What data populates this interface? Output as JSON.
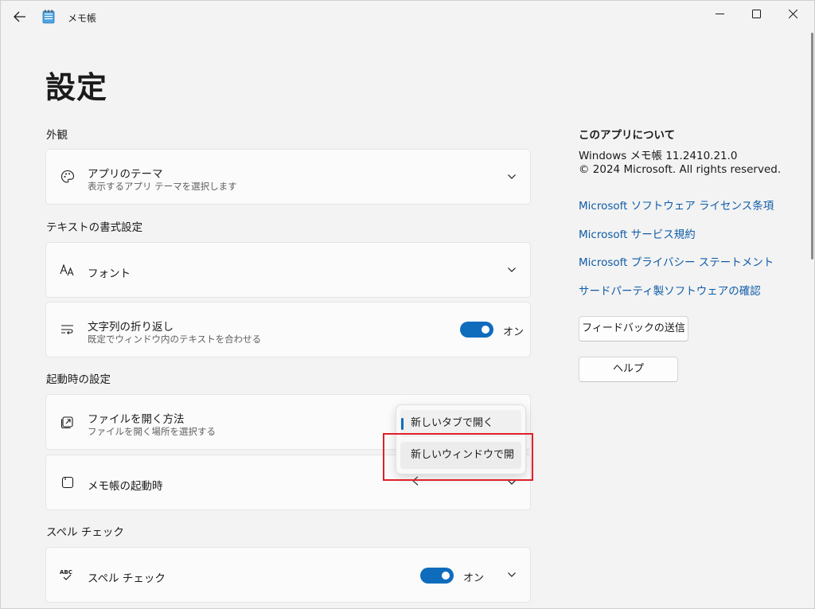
{
  "titlebar": {
    "app_title": "メモ帳"
  },
  "page": {
    "title": "設定"
  },
  "sections": {
    "appearance": "外観",
    "text_format": "テキストの書式設定",
    "startup": "起動時の設定",
    "spell": "スペル チェック"
  },
  "cards": {
    "theme": {
      "title": "アプリのテーマ",
      "subtitle": "表示するアプリ テーマを選択します"
    },
    "font": {
      "title": "フォント"
    },
    "wrap": {
      "title": "文字列の折り返し",
      "subtitle": "既定でウィンドウ内のテキストを合わせる",
      "toggle_label": "オン"
    },
    "open_file": {
      "title": "ファイルを開く方法",
      "subtitle": "ファイルを開く場所を選択する"
    },
    "startup": {
      "title": "メモ帳の起動時"
    },
    "spell": {
      "title": "スペル チェック",
      "toggle_label": "オン"
    }
  },
  "dropdown": {
    "options": [
      "新しいタブで開く",
      "新しいウィンドウで開く"
    ],
    "selected": "新しいタブで開く"
  },
  "about": {
    "title": "このアプリについて",
    "version": "Windows メモ帳 11.2410.21.0",
    "copyright": "© 2024 Microsoft. All rights reserved.",
    "links": [
      "Microsoft ソフトウェア ライセンス条項",
      "Microsoft サービス規約",
      "Microsoft プライバシー ステートメント",
      "サードパーティ製ソフトウェアの確認"
    ],
    "feedback_button": "フィードバックの送信",
    "help_button": "ヘルプ"
  },
  "colors": {
    "accent": "#0f6cbd",
    "link": "#0f5ca8",
    "highlight": "#e0202a"
  }
}
